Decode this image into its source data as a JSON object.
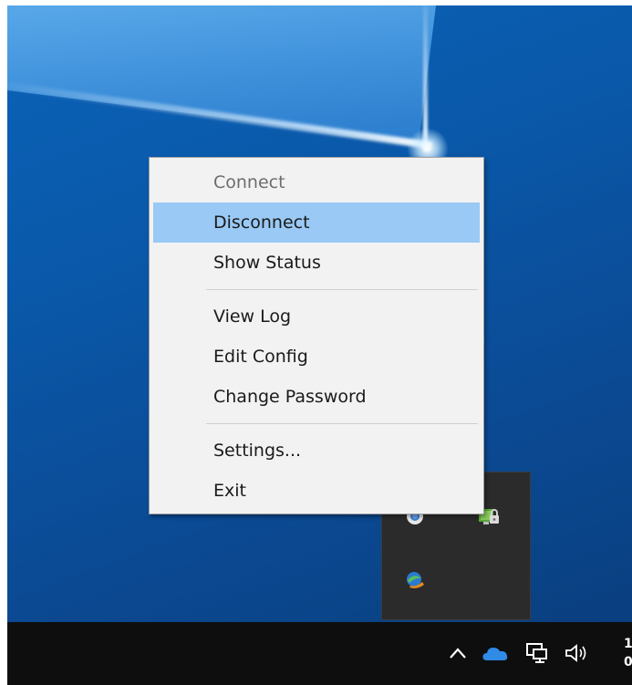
{
  "context_menu": {
    "items": [
      {
        "label": "Connect",
        "disabled": true
      },
      {
        "label": "Disconnect",
        "highlighted": true
      },
      {
        "label": "Show Status"
      },
      {
        "label": "View Log"
      },
      {
        "label": "Edit Config"
      },
      {
        "label": "Change Password"
      },
      {
        "label": "Settings..."
      },
      {
        "label": "Exit"
      }
    ]
  },
  "tray_popup": {
    "icons": [
      "chrome-icon",
      "openvpn-lock-icon",
      "idm-globe-icon"
    ]
  },
  "taskbar": {
    "icons": [
      "chevron-up-icon",
      "onedrive-cloud-icon",
      "network-icon",
      "speaker-icon"
    ],
    "clock_line1": "1",
    "clock_line2": "0"
  },
  "colors": {
    "menu_bg": "#f2f2f2",
    "menu_highlight": "#99c9f4",
    "taskbar_bg": "#0e0e0f",
    "desktop_blue": "#0a58a9",
    "onedrive_blue": "#2f8be6"
  }
}
